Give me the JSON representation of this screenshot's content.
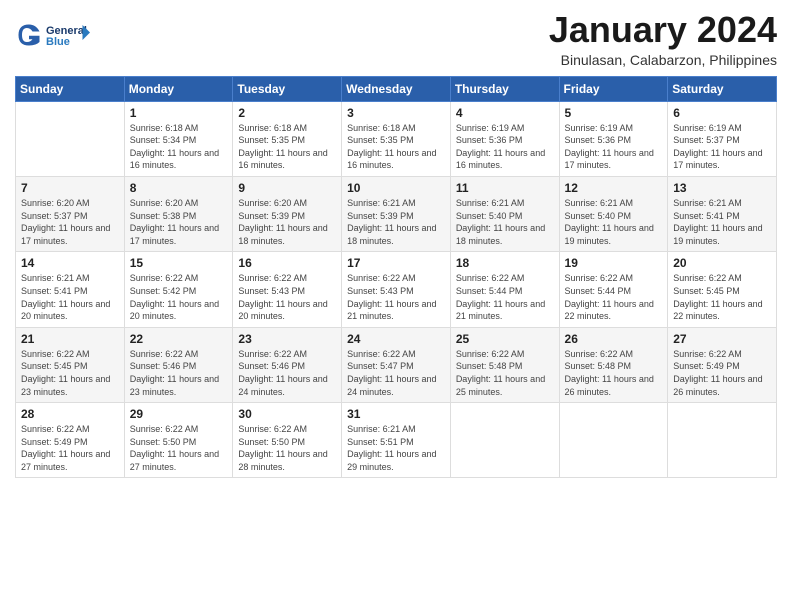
{
  "header": {
    "logo_line1": "General",
    "logo_line2": "Blue",
    "title": "January 2024",
    "subtitle": "Binulasan, Calabarzon, Philippines"
  },
  "weekdays": [
    "Sunday",
    "Monday",
    "Tuesday",
    "Wednesday",
    "Thursday",
    "Friday",
    "Saturday"
  ],
  "weeks": [
    [
      {
        "day": "",
        "sunrise": "",
        "sunset": "",
        "daylight": ""
      },
      {
        "day": "1",
        "sunrise": "Sunrise: 6:18 AM",
        "sunset": "Sunset: 5:34 PM",
        "daylight": "Daylight: 11 hours and 16 minutes."
      },
      {
        "day": "2",
        "sunrise": "Sunrise: 6:18 AM",
        "sunset": "Sunset: 5:35 PM",
        "daylight": "Daylight: 11 hours and 16 minutes."
      },
      {
        "day": "3",
        "sunrise": "Sunrise: 6:18 AM",
        "sunset": "Sunset: 5:35 PM",
        "daylight": "Daylight: 11 hours and 16 minutes."
      },
      {
        "day": "4",
        "sunrise": "Sunrise: 6:19 AM",
        "sunset": "Sunset: 5:36 PM",
        "daylight": "Daylight: 11 hours and 16 minutes."
      },
      {
        "day": "5",
        "sunrise": "Sunrise: 6:19 AM",
        "sunset": "Sunset: 5:36 PM",
        "daylight": "Daylight: 11 hours and 17 minutes."
      },
      {
        "day": "6",
        "sunrise": "Sunrise: 6:19 AM",
        "sunset": "Sunset: 5:37 PM",
        "daylight": "Daylight: 11 hours and 17 minutes."
      }
    ],
    [
      {
        "day": "7",
        "sunrise": "Sunrise: 6:20 AM",
        "sunset": "Sunset: 5:37 PM",
        "daylight": "Daylight: 11 hours and 17 minutes."
      },
      {
        "day": "8",
        "sunrise": "Sunrise: 6:20 AM",
        "sunset": "Sunset: 5:38 PM",
        "daylight": "Daylight: 11 hours and 17 minutes."
      },
      {
        "day": "9",
        "sunrise": "Sunrise: 6:20 AM",
        "sunset": "Sunset: 5:39 PM",
        "daylight": "Daylight: 11 hours and 18 minutes."
      },
      {
        "day": "10",
        "sunrise": "Sunrise: 6:21 AM",
        "sunset": "Sunset: 5:39 PM",
        "daylight": "Daylight: 11 hours and 18 minutes."
      },
      {
        "day": "11",
        "sunrise": "Sunrise: 6:21 AM",
        "sunset": "Sunset: 5:40 PM",
        "daylight": "Daylight: 11 hours and 18 minutes."
      },
      {
        "day": "12",
        "sunrise": "Sunrise: 6:21 AM",
        "sunset": "Sunset: 5:40 PM",
        "daylight": "Daylight: 11 hours and 19 minutes."
      },
      {
        "day": "13",
        "sunrise": "Sunrise: 6:21 AM",
        "sunset": "Sunset: 5:41 PM",
        "daylight": "Daylight: 11 hours and 19 minutes."
      }
    ],
    [
      {
        "day": "14",
        "sunrise": "Sunrise: 6:21 AM",
        "sunset": "Sunset: 5:41 PM",
        "daylight": "Daylight: 11 hours and 20 minutes."
      },
      {
        "day": "15",
        "sunrise": "Sunrise: 6:22 AM",
        "sunset": "Sunset: 5:42 PM",
        "daylight": "Daylight: 11 hours and 20 minutes."
      },
      {
        "day": "16",
        "sunrise": "Sunrise: 6:22 AM",
        "sunset": "Sunset: 5:43 PM",
        "daylight": "Daylight: 11 hours and 20 minutes."
      },
      {
        "day": "17",
        "sunrise": "Sunrise: 6:22 AM",
        "sunset": "Sunset: 5:43 PM",
        "daylight": "Daylight: 11 hours and 21 minutes."
      },
      {
        "day": "18",
        "sunrise": "Sunrise: 6:22 AM",
        "sunset": "Sunset: 5:44 PM",
        "daylight": "Daylight: 11 hours and 21 minutes."
      },
      {
        "day": "19",
        "sunrise": "Sunrise: 6:22 AM",
        "sunset": "Sunset: 5:44 PM",
        "daylight": "Daylight: 11 hours and 22 minutes."
      },
      {
        "day": "20",
        "sunrise": "Sunrise: 6:22 AM",
        "sunset": "Sunset: 5:45 PM",
        "daylight": "Daylight: 11 hours and 22 minutes."
      }
    ],
    [
      {
        "day": "21",
        "sunrise": "Sunrise: 6:22 AM",
        "sunset": "Sunset: 5:45 PM",
        "daylight": "Daylight: 11 hours and 23 minutes."
      },
      {
        "day": "22",
        "sunrise": "Sunrise: 6:22 AM",
        "sunset": "Sunset: 5:46 PM",
        "daylight": "Daylight: 11 hours and 23 minutes."
      },
      {
        "day": "23",
        "sunrise": "Sunrise: 6:22 AM",
        "sunset": "Sunset: 5:46 PM",
        "daylight": "Daylight: 11 hours and 24 minutes."
      },
      {
        "day": "24",
        "sunrise": "Sunrise: 6:22 AM",
        "sunset": "Sunset: 5:47 PM",
        "daylight": "Daylight: 11 hours and 24 minutes."
      },
      {
        "day": "25",
        "sunrise": "Sunrise: 6:22 AM",
        "sunset": "Sunset: 5:48 PM",
        "daylight": "Daylight: 11 hours and 25 minutes."
      },
      {
        "day": "26",
        "sunrise": "Sunrise: 6:22 AM",
        "sunset": "Sunset: 5:48 PM",
        "daylight": "Daylight: 11 hours and 26 minutes."
      },
      {
        "day": "27",
        "sunrise": "Sunrise: 6:22 AM",
        "sunset": "Sunset: 5:49 PM",
        "daylight": "Daylight: 11 hours and 26 minutes."
      }
    ],
    [
      {
        "day": "28",
        "sunrise": "Sunrise: 6:22 AM",
        "sunset": "Sunset: 5:49 PM",
        "daylight": "Daylight: 11 hours and 27 minutes."
      },
      {
        "day": "29",
        "sunrise": "Sunrise: 6:22 AM",
        "sunset": "Sunset: 5:50 PM",
        "daylight": "Daylight: 11 hours and 27 minutes."
      },
      {
        "day": "30",
        "sunrise": "Sunrise: 6:22 AM",
        "sunset": "Sunset: 5:50 PM",
        "daylight": "Daylight: 11 hours and 28 minutes."
      },
      {
        "day": "31",
        "sunrise": "Sunrise: 6:21 AM",
        "sunset": "Sunset: 5:51 PM",
        "daylight": "Daylight: 11 hours and 29 minutes."
      },
      {
        "day": "",
        "sunrise": "",
        "sunset": "",
        "daylight": ""
      },
      {
        "day": "",
        "sunrise": "",
        "sunset": "",
        "daylight": ""
      },
      {
        "day": "",
        "sunrise": "",
        "sunset": "",
        "daylight": ""
      }
    ]
  ]
}
